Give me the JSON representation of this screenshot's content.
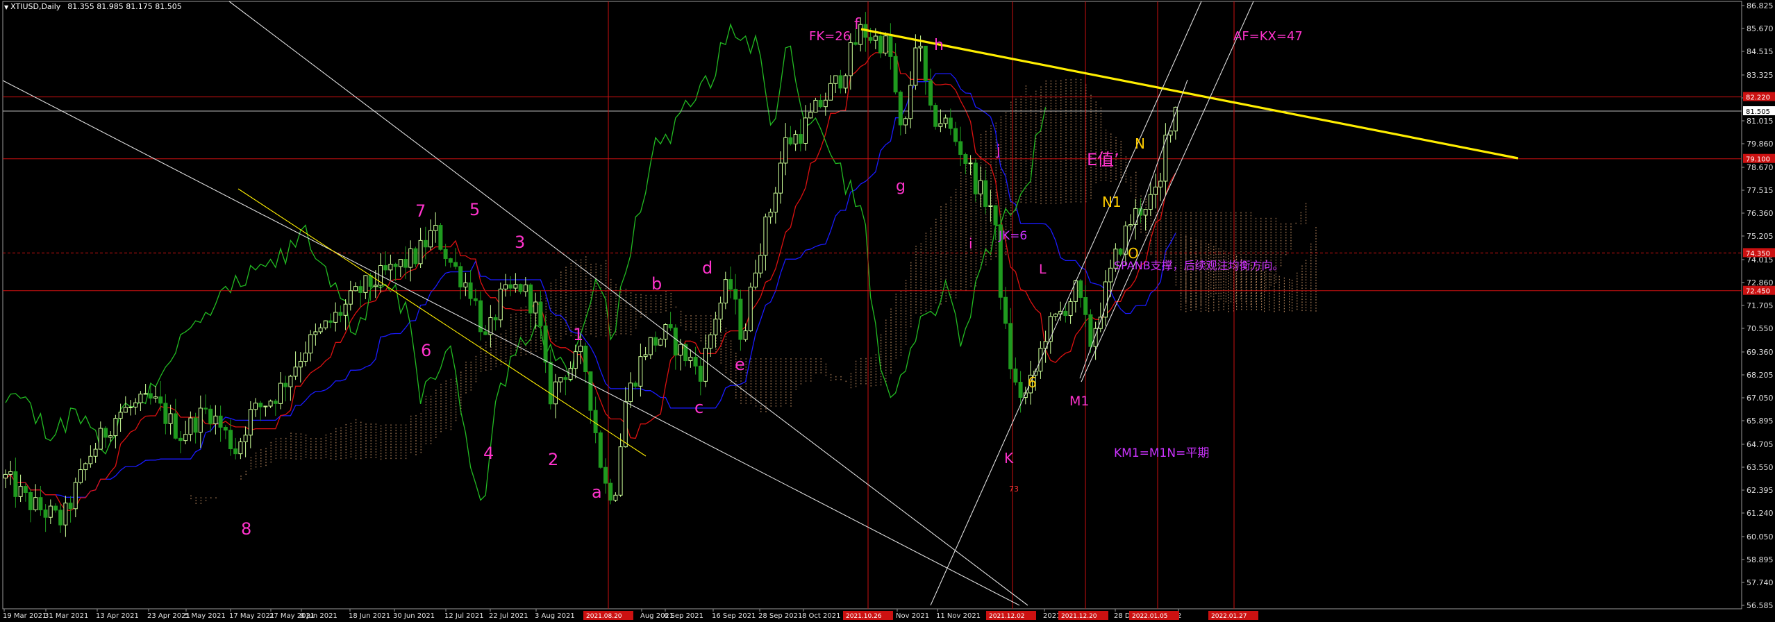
{
  "header": {
    "symbol_title": "XTIUSD,Daily",
    "ohlc": "81.355 81.985 81.175 81.505"
  },
  "chart_data": {
    "type": "candlestick",
    "symbol": "XTIUSD",
    "timeframe": "Daily",
    "y_ticks": [
      "86.825",
      "85.670",
      "84.515",
      "83.325",
      "82.170",
      "81.015",
      "79.860",
      "78.670",
      "77.515",
      "76.360",
      "75.205",
      "74.015",
      "72.860",
      "71.705",
      "70.550",
      "69.360",
      "68.205",
      "67.050",
      "65.895",
      "64.705",
      "63.550",
      "62.395",
      "61.240",
      "60.050",
      "58.895",
      "57.740",
      "56.585"
    ],
    "ylim": [
      56.585,
      86.825
    ],
    "price_tags": [
      {
        "value": 81.505,
        "text": "81.505",
        "style": "current"
      },
      {
        "value": 82.22,
        "text": "82.220",
        "style": "red"
      },
      {
        "value": 79.1,
        "text": "79.100",
        "style": "red"
      },
      {
        "value": 74.35,
        "text": "74.350",
        "style": "red"
      },
      {
        "value": 72.45,
        "text": "72.450",
        "style": "red"
      }
    ],
    "x_labels": [
      "19 Mar 2021",
      "31 Mar 2021",
      "13 Apr 2021",
      "23 Apr 2021",
      "5 May 2021",
      "17 May 2021",
      "27 May 2021",
      "8 Jun 2021",
      "18 Jun 2021",
      "30 Jun 2021",
      "12 Jul 2021",
      "22 Jul 2021",
      "3 Aug 2021",
      "Aug 2021",
      "6 Sep 2021",
      "16 Sep 2021",
      "28 Sep 2021",
      "8 Oct 2021",
      "Nov 2021",
      "11 Nov 2021",
      "2021",
      "28 De",
      "2"
    ],
    "x_red_tags": [
      "2021.08.20",
      "2021.10.26",
      "2021.12.02",
      "2021.12.20",
      "2022.01.05",
      "2022.01.27"
    ],
    "horizontal_lines": [
      82.22,
      81.505,
      79.1,
      74.35,
      72.45
    ],
    "annotations": [
      {
        "text": "FK=26",
        "color": "#ff33cc"
      },
      {
        "text": "AF=KX=47",
        "color": "#ff33cc"
      },
      {
        "text": "E值’",
        "color": "#ff33cc"
      },
      {
        "text": "N",
        "color": "#ffcc00"
      },
      {
        "text": "N1",
        "color": "#ffcc00"
      },
      {
        "text": "O",
        "color": "#ffcc00"
      },
      {
        "text": "6",
        "color": "#ffcc00"
      },
      {
        "text": "SPANB支撑，后续观注均衡方向。",
        "color": "#cc33ff"
      },
      {
        "text": "KM1=M1N=平期",
        "color": "#cc33ff"
      },
      {
        "text": "JK=6",
        "color": "#cc33ff"
      },
      {
        "text": "M1",
        "color": "#ff33cc"
      },
      {
        "text": "L",
        "color": "#ff33cc"
      },
      {
        "text": "f",
        "color": "#ff33cc"
      },
      {
        "text": "h",
        "color": "#ff33cc"
      },
      {
        "text": "g",
        "color": "#ff33cc"
      },
      {
        "text": "j",
        "color": "#ff33cc"
      },
      {
        "text": "i",
        "color": "#ff33cc"
      },
      {
        "text": "K",
        "color": "#ff33cc"
      },
      {
        "text": "73",
        "color": "#ff3333"
      },
      {
        "text": "7",
        "color": "#ff33cc"
      },
      {
        "text": "5",
        "color": "#ff33cc"
      },
      {
        "text": "3",
        "color": "#ff33cc"
      },
      {
        "text": "6",
        "color": "#ff33cc"
      },
      {
        "text": "4",
        "color": "#ff33cc"
      },
      {
        "text": "2",
        "color": "#ff33cc"
      },
      {
        "text": "1",
        "color": "#ff33cc"
      },
      {
        "text": "8",
        "color": "#ff33cc"
      },
      {
        "text": "a",
        "color": "#ff33cc"
      },
      {
        "text": "b",
        "color": "#ff33cc"
      },
      {
        "text": "c",
        "color": "#ff33cc"
      },
      {
        "text": "d",
        "color": "#ff33cc"
      },
      {
        "text": "e",
        "color": "#ff33cc"
      }
    ],
    "colors": {
      "background": "#000000",
      "bull_candle": "#ccff99",
      "bear_candle": "#1f9a1f",
      "tenkan": "#dd1111",
      "kijun": "#1a1aff",
      "chikou": "#22bb22",
      "cloud": "#d8a070",
      "trendline_yellow": "#ffee00",
      "channel_lines": "#dddddd",
      "level_lines": "#cc1111"
    }
  }
}
